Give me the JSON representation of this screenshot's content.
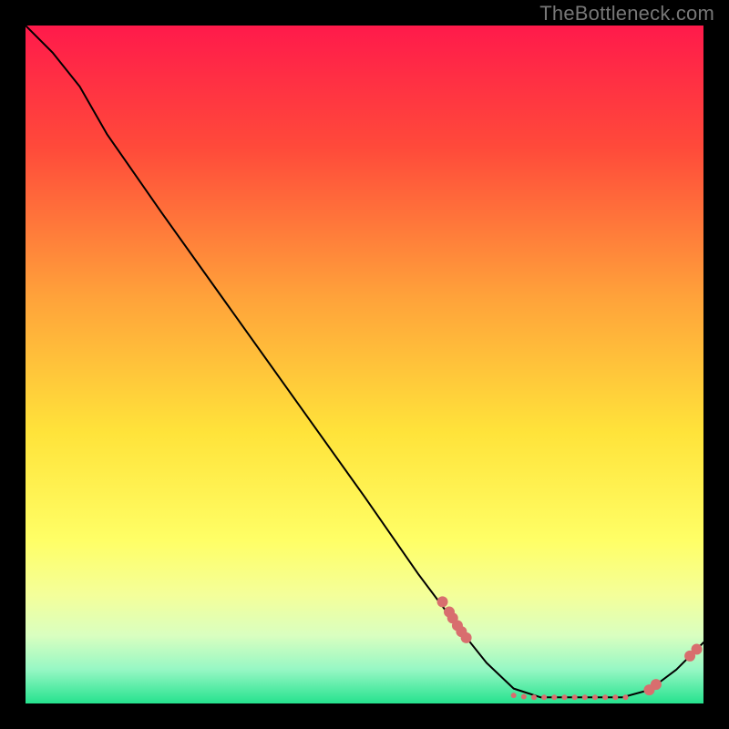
{
  "watermark": "TheBottleneck.com",
  "chart_data": {
    "type": "line",
    "title": "",
    "xlabel": "",
    "ylabel": "",
    "xlim": [
      0,
      100
    ],
    "ylim": [
      0,
      100
    ],
    "gradient_stops": [
      {
        "offset": 0,
        "color": "#ff1a4b"
      },
      {
        "offset": 18,
        "color": "#ff4a3a"
      },
      {
        "offset": 40,
        "color": "#ffa23a"
      },
      {
        "offset": 60,
        "color": "#ffe33a"
      },
      {
        "offset": 76,
        "color": "#ffff66"
      },
      {
        "offset": 84,
        "color": "#f4ff9a"
      },
      {
        "offset": 90,
        "color": "#d9ffc0"
      },
      {
        "offset": 95,
        "color": "#96f7c4"
      },
      {
        "offset": 100,
        "color": "#25e28e"
      }
    ],
    "curve": [
      {
        "x": 0,
        "y": 100
      },
      {
        "x": 4,
        "y": 96
      },
      {
        "x": 8,
        "y": 91
      },
      {
        "x": 12,
        "y": 84
      },
      {
        "x": 20,
        "y": 72.5
      },
      {
        "x": 30,
        "y": 58.5
      },
      {
        "x": 40,
        "y": 44.5
      },
      {
        "x": 50,
        "y": 30.5
      },
      {
        "x": 58,
        "y": 19
      },
      {
        "x": 64,
        "y": 11
      },
      {
        "x": 68,
        "y": 6
      },
      {
        "x": 72,
        "y": 2.2
      },
      {
        "x": 76,
        "y": 0.9
      },
      {
        "x": 82,
        "y": 0.9
      },
      {
        "x": 88,
        "y": 0.9
      },
      {
        "x": 92,
        "y": 2
      },
      {
        "x": 96,
        "y": 5
      },
      {
        "x": 100,
        "y": 9
      }
    ],
    "markers_main": [
      {
        "x": 61.5,
        "y": 15.0
      },
      {
        "x": 62.5,
        "y": 13.5
      },
      {
        "x": 63.0,
        "y": 12.6
      },
      {
        "x": 63.7,
        "y": 11.5
      },
      {
        "x": 64.3,
        "y": 10.6
      },
      {
        "x": 65.0,
        "y": 9.7
      }
    ],
    "markers_flat": [
      {
        "x": 72.0,
        "y": 1.2
      },
      {
        "x": 73.5,
        "y": 1.0
      },
      {
        "x": 75.0,
        "y": 0.9
      },
      {
        "x": 76.5,
        "y": 0.9
      },
      {
        "x": 78.0,
        "y": 0.9
      },
      {
        "x": 79.5,
        "y": 0.9
      },
      {
        "x": 81.0,
        "y": 0.9
      },
      {
        "x": 82.5,
        "y": 0.9
      },
      {
        "x": 84.0,
        "y": 0.9
      },
      {
        "x": 85.5,
        "y": 0.9
      },
      {
        "x": 87.0,
        "y": 0.9
      },
      {
        "x": 88.5,
        "y": 0.9
      }
    ],
    "markers_rise": [
      {
        "x": 92.0,
        "y": 2.0
      },
      {
        "x": 93.0,
        "y": 2.8
      },
      {
        "x": 98.0,
        "y": 7.0
      },
      {
        "x": 99.0,
        "y": 8.0
      }
    ],
    "marker_color": "#d86e6e",
    "marker_radius": 6,
    "flat_marker_radius": 3,
    "line_color": "#000000",
    "line_width": 2
  }
}
